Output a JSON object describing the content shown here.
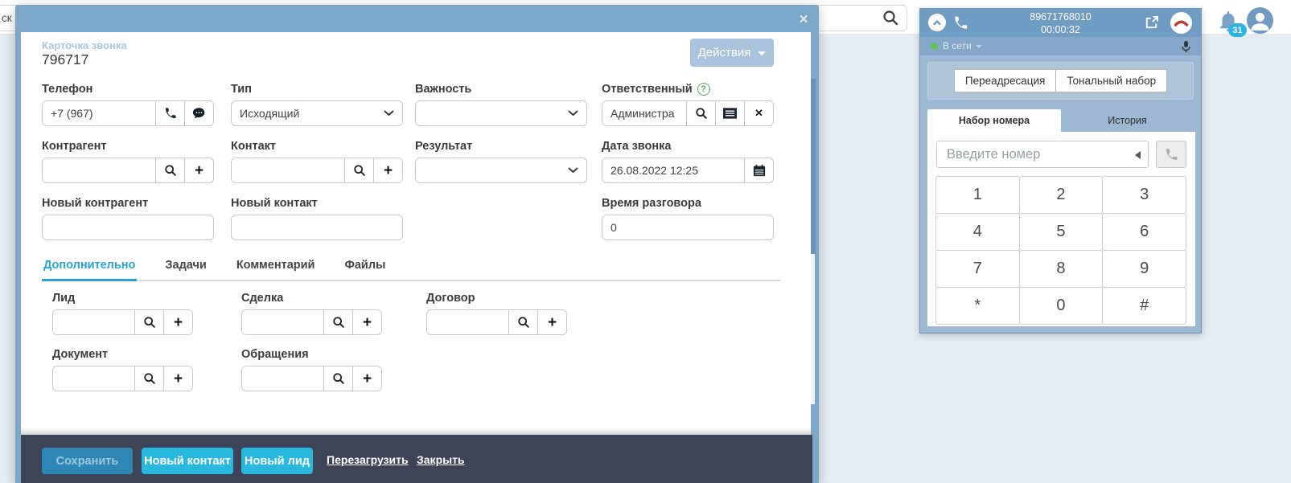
{
  "page": {
    "topbar_clipped_text": "ск",
    "notification_badge": "31"
  },
  "modal": {
    "subtitle": "Карточка звонка",
    "title": "796717",
    "actions_button": "Действия",
    "close": "×",
    "fields": {
      "phone": {
        "label": "Телефон",
        "value": "+7 (967)"
      },
      "type": {
        "label": "Тип",
        "value": "Исходящий"
      },
      "importance": {
        "label": "Важность",
        "value": ""
      },
      "responsible": {
        "label": "Ответственный",
        "value": "Администра"
      },
      "counterparty": {
        "label": "Контрагент",
        "value": ""
      },
      "contact": {
        "label": "Контакт",
        "value": ""
      },
      "result": {
        "label": "Результат",
        "value": ""
      },
      "call_date": {
        "label": "Дата звонка",
        "value": "26.08.2022 12:25"
      },
      "new_counterparty": {
        "label": "Новый контрагент",
        "value": ""
      },
      "new_contact": {
        "label": "Новый контакт",
        "value": ""
      },
      "talk_time": {
        "label": "Время разговора",
        "value": "0"
      }
    },
    "tabs": [
      "Дополнительно",
      "Задачи",
      "Комментарий",
      "Файлы"
    ],
    "tab_fields": {
      "lead": {
        "label": "Лид"
      },
      "deal": {
        "label": "Сделка"
      },
      "contract": {
        "label": "Договор"
      },
      "document": {
        "label": "Документ"
      },
      "appeals": {
        "label": "Обращения"
      }
    },
    "footer": {
      "save": "Сохранить",
      "new_contact": "Новый контакт",
      "new_lead": "Новый лид",
      "reload": "Перезагрузить",
      "close": "Закрыть"
    }
  },
  "phone_panel": {
    "number": "89671768010",
    "timer": "00:00:32",
    "status": "В сети",
    "forward_button": "Переадресация",
    "dtmf_button": "Тональный набор",
    "tab_dial": "Набор номера",
    "tab_history": "История",
    "input_placeholder": "Введите номер",
    "keypad": [
      "1",
      "2",
      "3",
      "4",
      "5",
      "6",
      "7",
      "8",
      "9",
      "*",
      "0",
      "#"
    ]
  },
  "colors": {
    "accent_cyan": "#29b8de",
    "steel_blue": "#7da7c9",
    "footer_navy": "#3d4458",
    "active_tab_blue": "#29a3d4",
    "badge_cyan": "#2db4e2",
    "online_green": "#5cc25c"
  }
}
